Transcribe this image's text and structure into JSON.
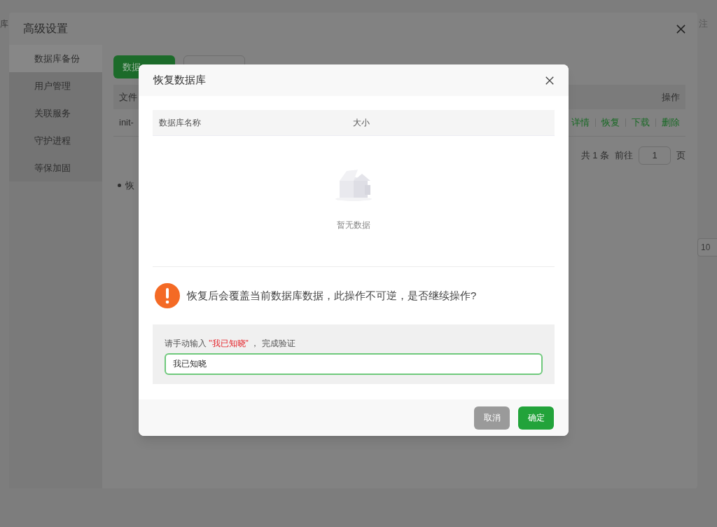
{
  "background": {
    "left_text": "库",
    "right_text": "注",
    "page_size": "10"
  },
  "settings_dialog": {
    "title": "高级设置",
    "sidebar": [
      {
        "label": "数据库备份",
        "selected": true
      },
      {
        "label": "用户管理",
        "selected": false
      },
      {
        "label": "关联服务",
        "selected": false
      },
      {
        "label": "守护进程",
        "selected": false
      },
      {
        "label": "等保加固",
        "selected": false
      }
    ],
    "toolbar": {
      "primary_button": "数据"
    },
    "table": {
      "columns": [
        "文件",
        "操作"
      ],
      "rows": [
        {
          "name": "init-",
          "actions": [
            "详情",
            "恢复",
            "下载",
            "删除"
          ]
        }
      ]
    },
    "pagination": {
      "total": "共 1 条",
      "goto": "前往",
      "page": "1",
      "page_unit": "页"
    },
    "note": "恢"
  },
  "restore_dialog": {
    "title": "恢复数据库",
    "table": {
      "columns": [
        "数据库名称",
        "大小"
      ],
      "empty_text": "暂无数据"
    },
    "warning": "恢复后会覆盖当前数据库数据，此操作不可逆，是否继续操作?",
    "verify": {
      "label": "请手动输入 **\"我已知晓\"** ， 完成验证",
      "value": "我已知晓",
      "focused": true
    },
    "buttons": [
      {
        "label": "取消",
        "kind": "cancel",
        "disabled": true
      },
      {
        "label": "确定",
        "kind": "confirm",
        "disabled": false
      }
    ]
  }
}
